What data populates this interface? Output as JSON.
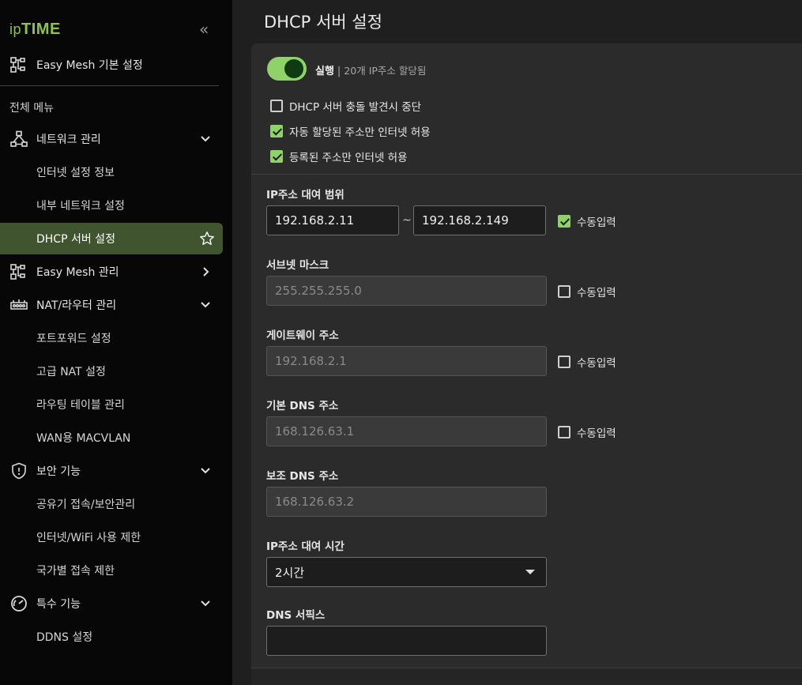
{
  "sidebar": {
    "logo_prefix": "ip",
    "logo_main": "TIME",
    "collapse_icon": "«",
    "easy_mesh_basic": "Easy Mesh 기본 설정",
    "all_menu": "전체 메뉴",
    "items": [
      {
        "label": "네트워크 관리",
        "icon": "network-icon"
      },
      {
        "label": "인터넷 설정 정보"
      },
      {
        "label": "내부 네트워크 설정"
      },
      {
        "label": "DHCP 서버 설정",
        "active": true
      },
      {
        "label": "Easy Mesh 관리",
        "icon": "mesh-icon"
      },
      {
        "label": "NAT/라우터 관리",
        "icon": "router-icon"
      },
      {
        "label": "포트포워드 설정"
      },
      {
        "label": "고급 NAT 설정"
      },
      {
        "label": "라우팅 테이블 관리"
      },
      {
        "label": "WAN용 MACVLAN"
      },
      {
        "label": "보안 기능",
        "icon": "shield-icon"
      },
      {
        "label": "공유기 접속/보안관리"
      },
      {
        "label": "인터넷/WiFi 사용 제한"
      },
      {
        "label": "국가별 접속 제한"
      },
      {
        "label": "특수 기능",
        "icon": "gauge-icon"
      },
      {
        "label": "DDNS 설정"
      }
    ]
  },
  "main": {
    "title": "DHCP 서버 설정",
    "status_on": "실행",
    "status_sep": "|",
    "status_sub": "20개 IP주소 할당됨",
    "options": [
      {
        "label": "DHCP 서버 충돌 발견시 중단",
        "checked": false
      },
      {
        "label": "자동 할당된 주소만 인터넷 허용",
        "checked": true
      },
      {
        "label": "등록된 주소만 인터넷 허용",
        "checked": true
      }
    ],
    "ip_range": {
      "label": "IP주소 대여 범위",
      "start": "192.168.2.11",
      "tilde": "~",
      "end": "192.168.2.149",
      "manual": "수동입력",
      "manual_checked": true
    },
    "subnet": {
      "label": "서브넷 마스크",
      "value": "255.255.255.0",
      "manual": "수동입력",
      "manual_checked": false
    },
    "gateway": {
      "label": "게이트웨이 주소",
      "value": "192.168.2.1",
      "manual": "수동입력",
      "manual_checked": false
    },
    "dns1": {
      "label": "기본 DNS 주소",
      "value": "168.126.63.1",
      "manual": "수동입력",
      "manual_checked": false
    },
    "dns2": {
      "label": "보조 DNS 주소",
      "value": "168.126.63.2"
    },
    "lease": {
      "label": "IP주소 대여 시간",
      "value": "2시간"
    },
    "suffix": {
      "label": "DNS 서픽스",
      "value": ""
    }
  },
  "colors": {
    "accent": "#8fd26a",
    "active_nav": "#40552f",
    "logo": "#8fc24a"
  }
}
